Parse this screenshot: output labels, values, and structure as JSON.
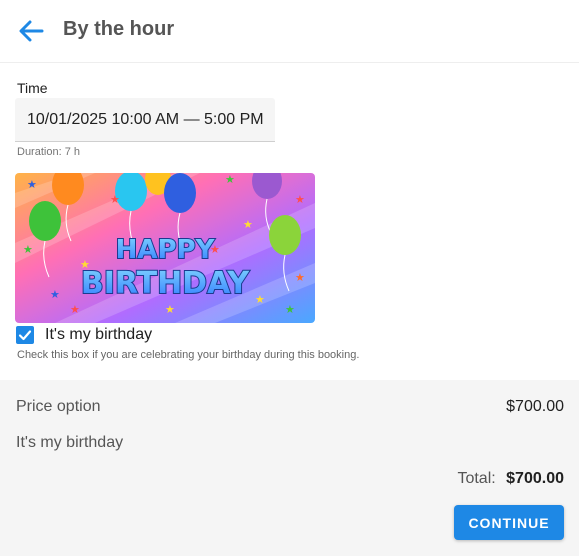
{
  "header": {
    "title": "By the hour",
    "back_icon": "arrow-left-icon"
  },
  "time": {
    "label": "Time",
    "value": "10/01/2025 10:00 AM — 5:00 PM",
    "duration": "Duration: 7 h"
  },
  "banner": {
    "line1": "HAPPY",
    "line2": "BIRTHDAY"
  },
  "birthday": {
    "checked": true,
    "label": "It's my birthday",
    "helper": "Check this box if you are celebrating your birthday during this booking."
  },
  "summary": {
    "price_option_label": "Price option",
    "price_option_value": "$700.00",
    "birthday_line": "It's my birthday",
    "total_label": "Total:",
    "total_value": "$700.00",
    "continue_label": "CONTINUE"
  },
  "colors": {
    "accent": "#1e88e5"
  }
}
